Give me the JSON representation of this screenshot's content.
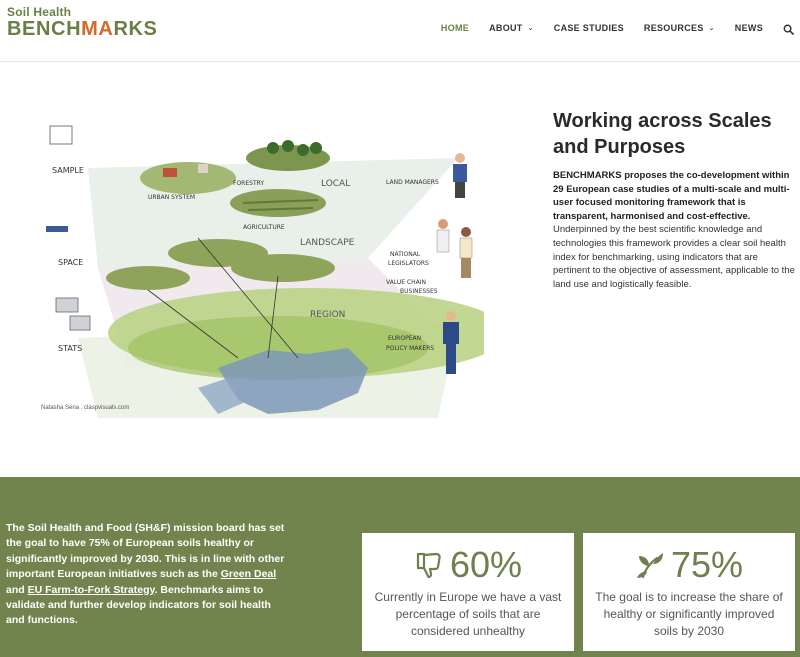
{
  "header": {
    "logo_top": "Soil Health",
    "logo_main_left": "BENCH",
    "logo_main_accent": "MA",
    "logo_main_right": "RKS",
    "nav": {
      "home": "HOME",
      "about": "ABOUT",
      "case_studies": "CASE STUDIES",
      "resources": "RESOURCES",
      "news": "NEWS"
    },
    "search_icon": "search-icon"
  },
  "hero": {
    "title": "Working across Scales and Purposes",
    "desc_bold": "BENCHMARKS proposes the co-development within 29 European case studies of a multi-scale and multi-user focused monitoring framework that is transparent, harmonised and cost-effective.",
    "desc_rest": " Underpinned by the best scientific knowledge and technologies this framework provides a clear soil health index for benchmarking, using indicators that are pertinent to the objective of assessment, applicable to the land use and logistically feasible.",
    "illustration": {
      "credit": "Natasha Sena . claspvisuals.com",
      "labels": {
        "sample": "SAMPLE",
        "space": "SPACE",
        "stats": "STATS",
        "urban": "URBAN SYSTEM",
        "forestry": "FORESTRY",
        "agriculture": "AGRICULTURE",
        "local": "LOCAL",
        "landscape": "LANDSCAPE",
        "region": "REGION",
        "land_managers": "LAND MANAGERS",
        "national": "NATIONAL",
        "legislators": "LEGISLATORS",
        "value_chain": "VALUE CHAIN",
        "businesses": "BUSINESSES",
        "european": "EUROPEAN",
        "policy_makers": "POLICY MAKERS"
      }
    }
  },
  "mission": {
    "text_1": "The Soil Health and Food (SH&F) mission board has set the goal to have 75% of European soils healthy or significantly improved by 2030. This is in line with other important European initiatives such as the ",
    "link_green_deal": "Green Deal",
    "text_2": " and ",
    "link_farm_to_fork": "EU Farm-to-Fork Strategy",
    "text_3": ". Benchmarks aims to validate and further develop indicators for soil health and functions."
  },
  "stats": [
    {
      "icon": "thumbs-down-icon",
      "value": "60%",
      "text": "Currently in Europe we have a vast percentage of soils that are considered unhealthy"
    },
    {
      "icon": "sprout-icon",
      "value": "75%",
      "text": "The goal is to increase the share of healthy or significantly improved soils by 2030"
    }
  ],
  "colors": {
    "brand_green": "#71844d",
    "accent_orange": "#d36a2c",
    "stat_green": "#6f7f4f"
  }
}
